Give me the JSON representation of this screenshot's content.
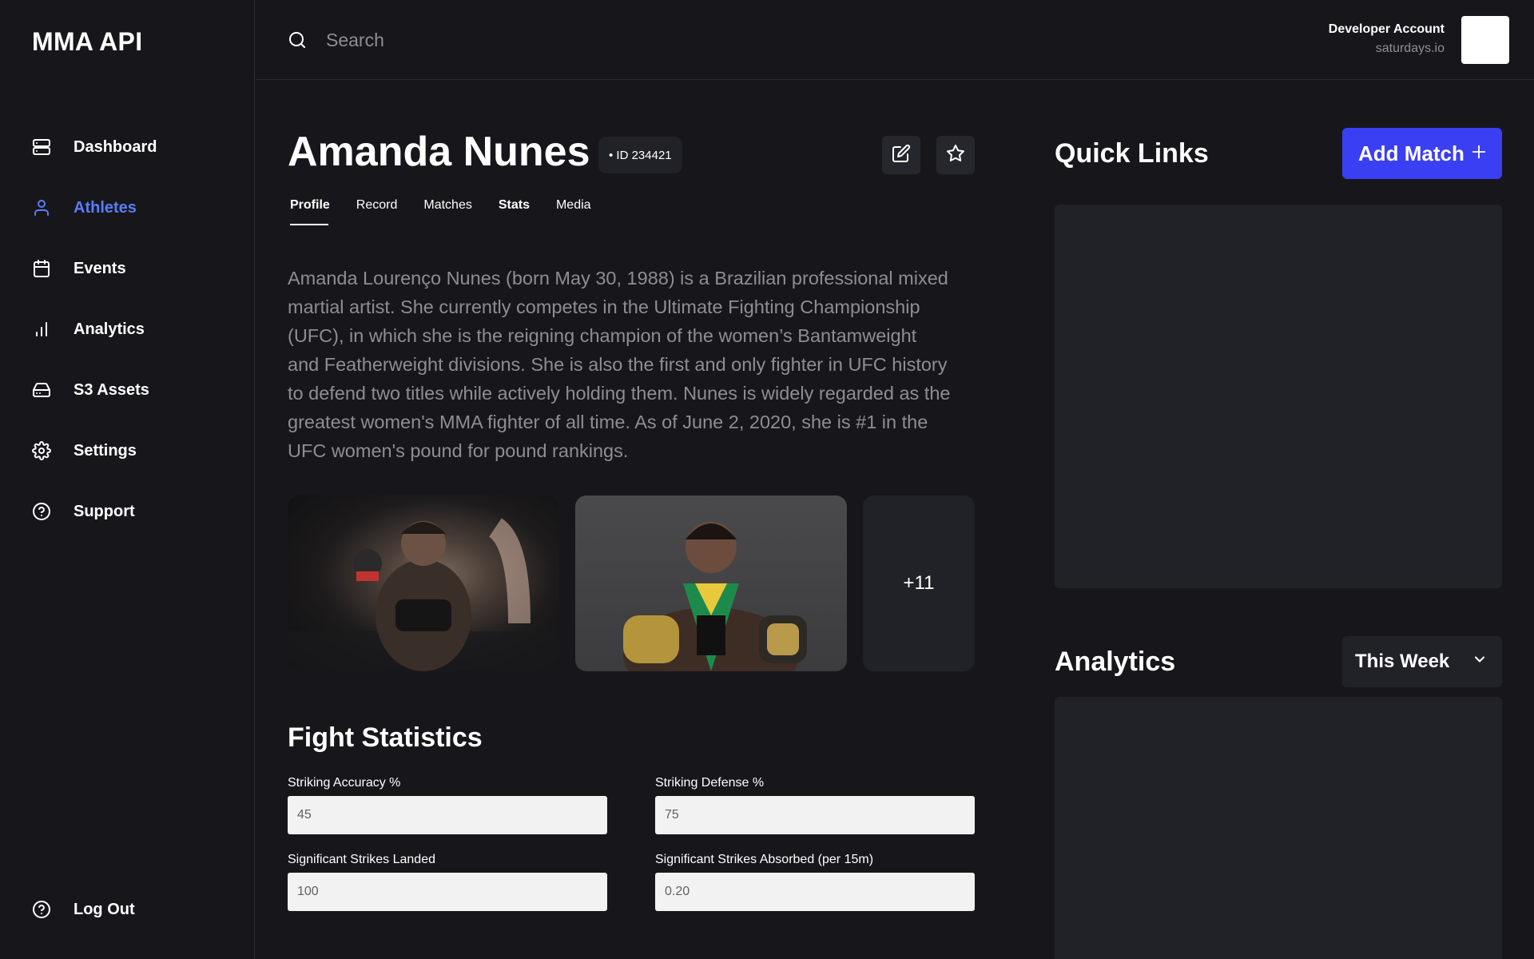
{
  "app": {
    "title": "MMA API"
  },
  "sidebar": {
    "items": [
      {
        "label": "Dashboard",
        "icon": "server-icon"
      },
      {
        "label": "Athletes",
        "icon": "user-icon",
        "active": true
      },
      {
        "label": "Events",
        "icon": "calendar-icon"
      },
      {
        "label": "Analytics",
        "icon": "bar-chart-icon"
      },
      {
        "label": "S3 Assets",
        "icon": "hard-drive-icon"
      },
      {
        "label": "Settings",
        "icon": "gear-icon"
      },
      {
        "label": "Support",
        "icon": "help-circle-icon"
      }
    ],
    "logout": {
      "label": "Log Out",
      "icon": "help-circle-icon"
    }
  },
  "search": {
    "placeholder": "Search"
  },
  "account": {
    "name": "Developer Account",
    "domain": "saturdays.io"
  },
  "athlete": {
    "name": "Amanda Nunes",
    "id_badge": "• ID 234421",
    "tabs": [
      "Profile",
      "Record",
      "Matches",
      "Stats",
      "Media"
    ],
    "active_tab": "Profile",
    "bio": "Amanda Lourenço Nunes (born May 30, 1988) is a Brazilian professional mixed martial artist. She currently competes in the Ultimate Fighting Championship (UFC), in which she is the reigning champion of the women’s Bantamweight and Featherweight divisions. She is also the first and only fighter in UFC history to defend two titles while actively holding them. Nunes is widely regarded as the greatest women's MMA fighter of all time. As of June 2, 2020, she is #1 in the UFC women's pound for pound rankings.",
    "media_more": "+11"
  },
  "fight_stats": {
    "title": "Fight Statistics",
    "fields": [
      {
        "label": "Striking Accuracy %",
        "value": "45"
      },
      {
        "label": "Striking Defense %",
        "value": "75"
      },
      {
        "label": "Significant Strikes Landed",
        "value": "100"
      },
      {
        "label": "Significant Strikes Absorbed (per 15m)",
        "value": "0.20"
      }
    ]
  },
  "quick_links": {
    "title": "Quick Links",
    "add_match_label": "Add Match"
  },
  "analytics": {
    "title": "Analytics",
    "period": "This Week"
  },
  "colors": {
    "accent": "#3b3ff3",
    "active_nav": "#5b7cf7",
    "background": "#17171b",
    "panel": "#212128"
  }
}
